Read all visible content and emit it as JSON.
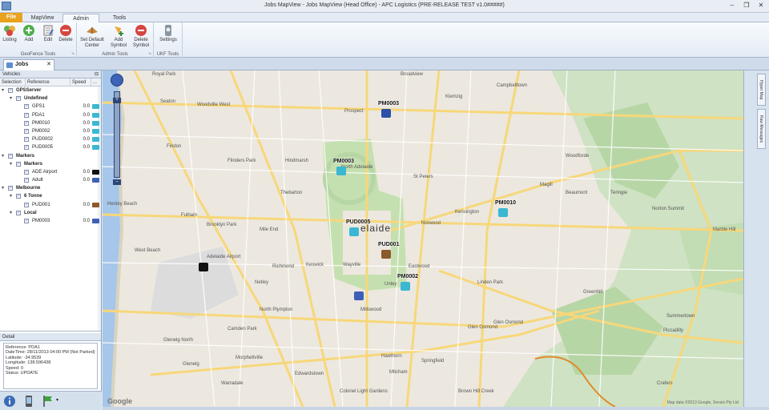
{
  "window": {
    "title": "Jobs MapView - Jobs MapView (Head Office) - APC Logistics (PRE-RELEASE TEST v1.0#####)",
    "buttons": [
      "–",
      "❐",
      "✕"
    ]
  },
  "ribbon": {
    "file_tab": "File",
    "tabs": [
      {
        "label": "MapView",
        "active": false
      },
      {
        "label": "Admin",
        "active": true
      },
      {
        "label": "Tools",
        "active": false
      }
    ],
    "groups": [
      {
        "label": "GeoFence Tools",
        "buttons": [
          {
            "label": "Listing",
            "icon": "listing-icon"
          },
          {
            "label": "Add",
            "icon": "add-icon"
          },
          {
            "label": "Edit",
            "icon": "edit-icon"
          },
          {
            "label": "Delete",
            "icon": "delete-icon"
          }
        ]
      },
      {
        "label": "Admin Tools",
        "buttons": [
          {
            "label": "Set Default Center",
            "icon": "set-center-icon"
          },
          {
            "label": "Add Symbol",
            "icon": "add-symbol-icon"
          },
          {
            "label": "Delete Symbol",
            "icon": "delete-symbol-icon"
          }
        ]
      },
      {
        "label": "UKF Tools",
        "buttons": [
          {
            "label": "Settings",
            "icon": "settings-icon"
          }
        ]
      }
    ]
  },
  "doc_tab": {
    "label": "Jobs MapView",
    "close": "✕"
  },
  "vehicles_panel": {
    "title": "Vehicles",
    "pin": "⊟",
    "columns": [
      "Selection",
      "Reference",
      "Speed",
      "..."
    ],
    "rows": [
      {
        "level": 0,
        "exp": "▾",
        "checked": true,
        "name": "GPSServer",
        "bold": true,
        "icon": "server-icon"
      },
      {
        "level": 1,
        "exp": "▾",
        "checked": true,
        "name": "Undefined",
        "bold": true
      },
      {
        "level": 2,
        "checked": true,
        "name": "GPS1",
        "speed": "0.0",
        "color": "#3bb7d3"
      },
      {
        "level": 2,
        "checked": true,
        "name": "PDA1",
        "speed": "0.0",
        "color": "#3bb7d3"
      },
      {
        "level": 2,
        "checked": true,
        "name": "PM0010",
        "speed": "0.0",
        "color": "#3bb7d3"
      },
      {
        "level": 2,
        "checked": true,
        "name": "PM0002",
        "speed": "0.0",
        "color": "#3bb7d3"
      },
      {
        "level": 2,
        "checked": true,
        "name": "PUD0002",
        "speed": "0.0",
        "color": "#3bb7d3"
      },
      {
        "level": 2,
        "checked": true,
        "name": "PUD0005",
        "speed": "0.0",
        "color": "#3bb7d3"
      },
      {
        "level": 0,
        "exp": "▾",
        "checked": true,
        "name": "Markers",
        "bold": true
      },
      {
        "level": 1,
        "exp": "▾",
        "checked": true,
        "name": "Markers",
        "bold": true
      },
      {
        "level": 2,
        "checked": true,
        "name": "ADE Airport",
        "speed": "0.0",
        "color": "#111111"
      },
      {
        "level": 2,
        "checked": true,
        "name": "Adult",
        "speed": "0.0",
        "color": "#3d5fb7"
      },
      {
        "level": 0,
        "exp": "▾",
        "checked": true,
        "name": "Melbourne",
        "bold": true
      },
      {
        "level": 1,
        "exp": "▾",
        "checked": true,
        "name": "6 Tonne",
        "bold": true
      },
      {
        "level": 2,
        "checked": true,
        "name": "PUD001",
        "speed": "0.0",
        "color": "#8a5a2b"
      },
      {
        "level": 1,
        "exp": "▾",
        "checked": true,
        "name": "Local",
        "bold": true
      },
      {
        "level": 2,
        "checked": true,
        "name": "PM0003",
        "speed": "0.0",
        "color": "#3d5fb7"
      }
    ]
  },
  "detail_panel": {
    "title": "Detail",
    "lines": [
      "Reference: PDA1",
      "DateTime: 28/11/2013 04:00 PM (Not Parked)",
      "Latitude: -34.9539",
      "Longitude: 138.596438",
      "Speed: 0",
      "Status: UPDATE"
    ]
  },
  "nav_icons": [
    "info-icon",
    "device-icon",
    "flag-icon"
  ],
  "map": {
    "city_label": "elaide",
    "place_labels": [
      "Royal Park",
      "Broadview",
      "Campbelltown",
      "Seaton",
      "Woodville West",
      "Prospect",
      "Klemzig",
      "Woodforde",
      "Findon",
      "Flinders Park",
      "Hindmarsh",
      "North Adelaide",
      "St Peters",
      "Magill",
      "Henley Beach",
      "Thebarton",
      "Kensington",
      "Beaumont",
      "Fulham",
      "Brooklyn Park",
      "Mile End",
      "Norwood",
      "West Beach",
      "Adelaide Airport",
      "Richmond",
      "Keswick",
      "Wayville",
      "Eastwood",
      "Linden Park",
      "Netley",
      "North Plympton",
      "Unley",
      "Glen Osmond",
      "Glenelg North",
      "Camden Park",
      "Millswood",
      "Mitcham",
      "Glenelg",
      "Morphettville",
      "Hawthorn",
      "Glen Osmond",
      "Warradale",
      "Edwardstown",
      "Springfield",
      "Colonel Light Gardens",
      "Brown Hill Creek",
      "Crafers",
      "Summertown",
      "Norton Summit",
      "Piccadilly",
      "Teringie",
      "Greenhill",
      "Marble Hill"
    ],
    "markers": [
      {
        "label": "PM0003",
        "color": "#2b4fa8"
      },
      {
        "label": "PM0003",
        "color": "#3bb7d3"
      },
      {
        "label": "PM0010",
        "color": "#3bb7d3"
      },
      {
        "label": "PUD0005",
        "color": "#3bb7d3"
      },
      {
        "label": "PUD001",
        "color": "#8a5a2b"
      },
      {
        "label": "PM0002",
        "color": "#3bb7d3"
      },
      {
        "label": "",
        "color": "#111111"
      },
      {
        "label": "",
        "color": "#3d5fb7"
      }
    ],
    "google": "Google",
    "copyright": "Map data ©2013 Google, Sensis Pty Ltd",
    "zoom_plus": "+",
    "zoom_minus": "–"
  },
  "right_tabs": [
    "Hyper Map",
    "Raw Messages"
  ]
}
